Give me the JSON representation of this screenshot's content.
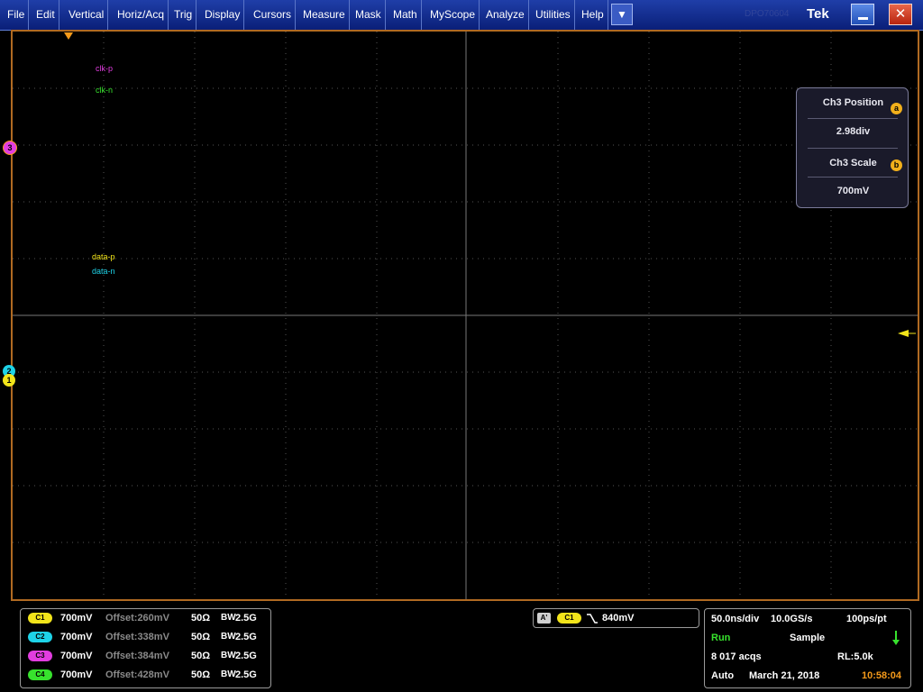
{
  "menu": {
    "items": [
      "File",
      "Edit",
      "Vertical",
      "Horiz/Acq",
      "Trig",
      "Display",
      "Cursors",
      "Measure",
      "Mask",
      "Math",
      "MyScope",
      "Analyze",
      "Utilities",
      "Help"
    ],
    "dropdown_icon": "triangle-down-icon",
    "ghost_text": "DPO70604",
    "brand": "Tek"
  },
  "colors": {
    "ch1": "#f2e41a",
    "ch2": "#1ed3e8",
    "ch3": "#e23de0",
    "ch4": "#37e22d",
    "trigger": "#f59a1a",
    "grid": "#6e6e6e"
  },
  "traces": {
    "clk_p": "clk-p",
    "clk_n": "clk-n",
    "data_p": "data-p",
    "data_n": "data-n",
    "marker_ch3": "3",
    "marker_ch2": "2",
    "marker_ch1": "1"
  },
  "popup": {
    "position_title": "Ch3 Position",
    "position_knob": "a",
    "position_value": "2.98div",
    "scale_title": "Ch3 Scale",
    "scale_knob": "b",
    "scale_value": "700mV"
  },
  "channels": [
    {
      "badge": "C1",
      "scale": "700mV",
      "offset": "Offset:260mV",
      "imp": "50Ω",
      "bw": "2.5G"
    },
    {
      "badge": "C2",
      "scale": "700mV",
      "offset": "Offset:338mV",
      "imp": "50Ω",
      "bw": "2.5G"
    },
    {
      "badge": "C3",
      "scale": "700mV",
      "offset": "Offset:384mV",
      "imp": "50Ω",
      "bw": "2.5G"
    },
    {
      "badge": "C4",
      "scale": "700mV",
      "offset": "Offset:428mV",
      "imp": "50Ω",
      "bw": "2.5G"
    }
  ],
  "bw_label": "BW",
  "trigger": {
    "mode": "A'",
    "source": "C1",
    "level": "840mV"
  },
  "acq": {
    "timebase": "50.0ns/div",
    "sample_rate": "10.0GS/s",
    "resolution": "100ps/pt",
    "state": "Run",
    "mode": "Sample",
    "count": "8 017 acqs",
    "record": "RL:5.0k",
    "trigger_mode": "Auto",
    "date": "March 21, 2018",
    "time": "10:58:04"
  }
}
